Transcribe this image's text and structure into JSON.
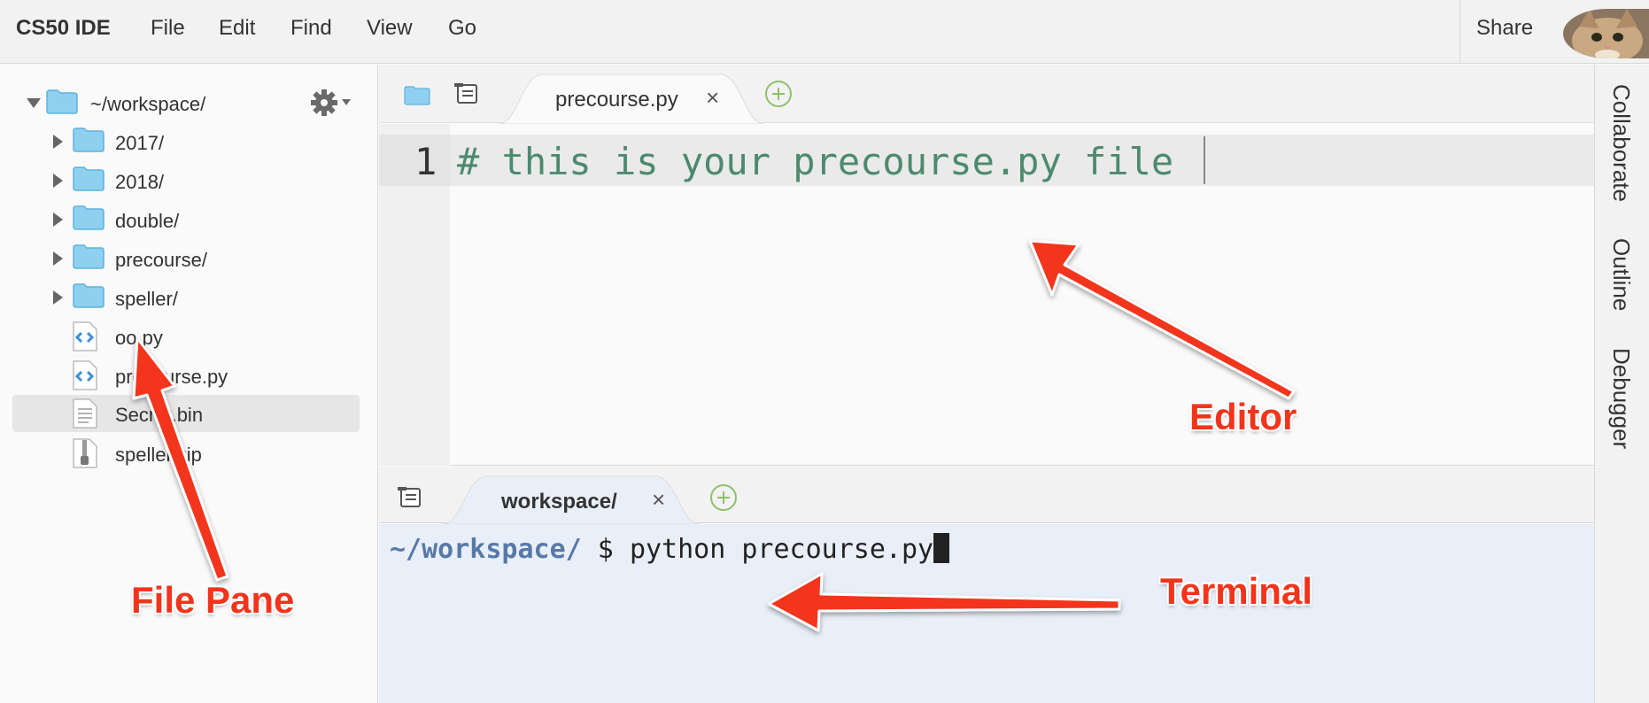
{
  "menubar": {
    "brand": "CS50 IDE",
    "items": [
      "File",
      "Edit",
      "Find",
      "View",
      "Go"
    ],
    "share_label": "Share"
  },
  "filetree": {
    "root": "~/workspace/",
    "items": [
      {
        "label": "2017/",
        "type": "folder"
      },
      {
        "label": "2018/",
        "type": "folder"
      },
      {
        "label": "double/",
        "type": "folder"
      },
      {
        "label": "precourse/",
        "type": "folder"
      },
      {
        "label": "speller/",
        "type": "folder"
      },
      {
        "label": "oo.py",
        "type": "python-file"
      },
      {
        "label": "precourse.py",
        "type": "python-file"
      },
      {
        "label": "Secret.bin",
        "type": "text-file",
        "selected": true
      },
      {
        "label": "speller.zip",
        "type": "zip-file"
      }
    ]
  },
  "editor": {
    "tab_label": "precourse.py",
    "line_number": "1",
    "code": "# this is your precourse.py file"
  },
  "terminal": {
    "tab_label": "workspace/",
    "prompt_path": "~/workspace/",
    "prompt_symbol": " $ ",
    "command": "python precourse.py"
  },
  "sidepanel": {
    "tabs": [
      "Collaborate",
      "Outline",
      "Debugger"
    ]
  },
  "annotations": {
    "file_pane": "File Pane",
    "editor": "Editor",
    "terminal": "Terminal"
  },
  "colors": {
    "annotation_red": "#f2341c",
    "comment_green": "#4c8a70",
    "terminal_path_blue": "#5779a8",
    "folder_blue": "#8fd0f0",
    "add_tab_green": "#8ec06c"
  }
}
